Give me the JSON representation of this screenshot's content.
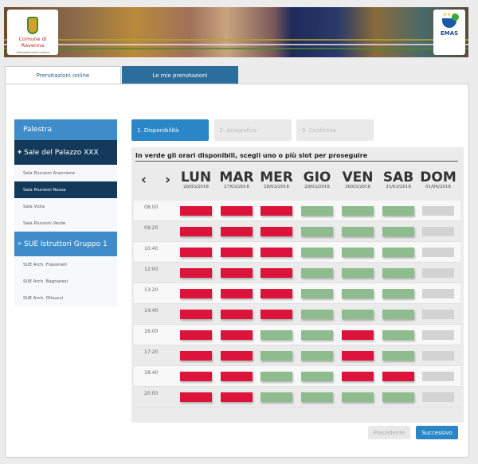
{
  "header": {
    "logo_left_text": "Comune di Ravenna",
    "logo_left_sub": "città patrimonio unesco",
    "logo_right_text": "EMAS"
  },
  "tabs": [
    {
      "label": "Prenotazioni online",
      "active": true
    },
    {
      "label": "Le mie prenotazioni",
      "active": false
    }
  ],
  "sidebar": {
    "title": "Palestra",
    "groups": [
      {
        "label": "Sale del Palazzo XXX",
        "icon": "plus-icon",
        "items": [
          {
            "label": "Sala Riunioni Arancione"
          },
          {
            "label": "Sala Riunioni Rossa",
            "selected": true
          },
          {
            "label": "Sala Viola"
          },
          {
            "label": "Sala Riunioni Verde"
          }
        ]
      },
      {
        "label": "SUE Istruttori Gruppo 1",
        "icon": "close-icon",
        "items": [
          {
            "label": "SUE Arch. Frassineti"
          },
          {
            "label": "SUE Arch. Bagnaresi"
          },
          {
            "label": "SUE Arch. Olivucci"
          }
        ]
      }
    ]
  },
  "steps": [
    {
      "label": "1. Disponibilità",
      "active": true
    },
    {
      "label": "2. Anagrafica"
    },
    {
      "label": "3. Conferma"
    }
  ],
  "calendar": {
    "headline": "In verde gli orari disponibili, scegli uno o più slot per proseguire",
    "prev_icon": "‹",
    "next_icon": "›",
    "days": [
      {
        "name": "LUN",
        "date": "26/03/2018"
      },
      {
        "name": "MAR",
        "date": "27/03/2018"
      },
      {
        "name": "MER",
        "date": "28/03/2018"
      },
      {
        "name": "GIO",
        "date": "29/03/2018"
      },
      {
        "name": "VEN",
        "date": "30/03/2018"
      },
      {
        "name": "SAB",
        "date": "31/03/2018"
      },
      {
        "name": "DOM",
        "date": "01/04/2018"
      }
    ],
    "legend_colors": {
      "occupied": "#dc143c",
      "available": "#8fbc8f",
      "closed": "#d3d3d3"
    },
    "slots": [
      {
        "time": "08:00",
        "states": [
          "occupied",
          "occupied",
          "occupied",
          "available",
          "available",
          "available",
          "closed"
        ]
      },
      {
        "time": "09:20",
        "states": [
          "occupied",
          "occupied",
          "occupied",
          "available",
          "available",
          "available",
          "closed"
        ]
      },
      {
        "time": "10:40",
        "states": [
          "occupied",
          "occupied",
          "occupied",
          "available",
          "available",
          "available",
          "closed"
        ]
      },
      {
        "time": "12:00",
        "states": [
          "occupied",
          "occupied",
          "occupied",
          "available",
          "available",
          "available",
          "closed"
        ]
      },
      {
        "time": "13:20",
        "states": [
          "occupied",
          "occupied",
          "occupied",
          "available",
          "available",
          "available",
          "closed"
        ]
      },
      {
        "time": "14:40",
        "states": [
          "occupied",
          "occupied",
          "occupied",
          "available",
          "available",
          "available",
          "closed"
        ]
      },
      {
        "time": "16:00",
        "states": [
          "occupied",
          "occupied",
          "available",
          "available",
          "occupied",
          "available",
          "closed"
        ]
      },
      {
        "time": "17:20",
        "states": [
          "occupied",
          "occupied",
          "available",
          "available",
          "occupied",
          "available",
          "closed"
        ]
      },
      {
        "time": "18:40",
        "states": [
          "occupied",
          "occupied",
          "available",
          "available",
          "occupied",
          "occupied",
          "closed"
        ]
      },
      {
        "time": "20:00",
        "states": [
          "occupied",
          "occupied",
          "available",
          "available",
          "available",
          "available",
          "closed"
        ]
      }
    ]
  },
  "buttons": {
    "prev": "Precedente",
    "next": "Successivo"
  }
}
